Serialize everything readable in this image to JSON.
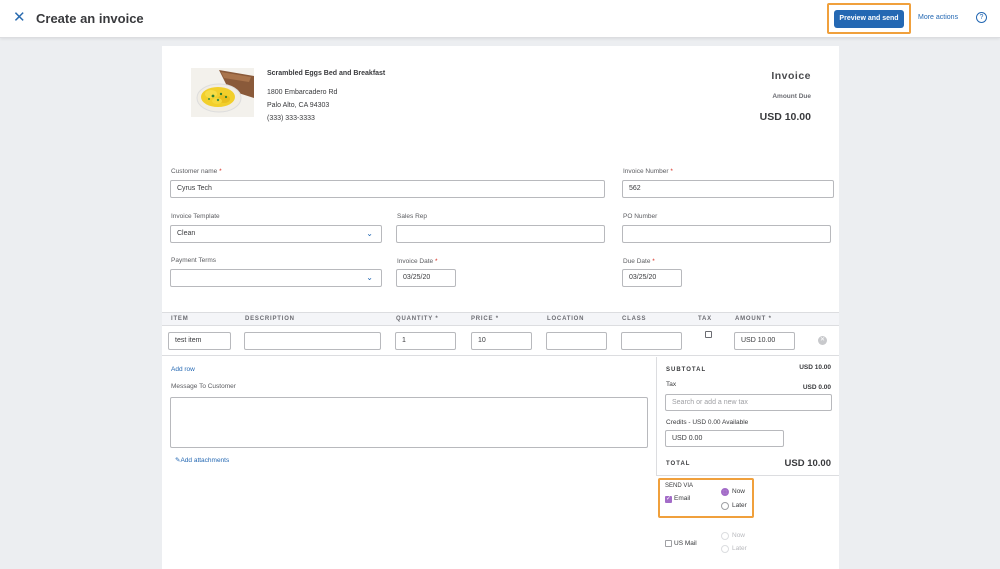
{
  "header": {
    "title": "Create an invoice",
    "primary_button": "Preview and send",
    "more_actions": "More actions",
    "help": "?"
  },
  "company": {
    "name": "Scrambled Eggs Bed and Breakfast",
    "address1": "1800 Embarcadero Rd",
    "address2": "Palo Alto, CA 94303",
    "phone": "(333) 333-3333"
  },
  "summary": {
    "label": "Invoice",
    "amount_due_label": "Amount Due",
    "amount_due": "USD 10.00"
  },
  "fields": {
    "customer_name_label": "Customer name",
    "customer_name": "Cyrus Tech",
    "invoice_number_label": "Invoice Number",
    "invoice_number": "562",
    "template_label": "Invoice Template",
    "template": "Clean",
    "sales_rep_label": "Sales Rep",
    "sales_rep": "",
    "po_number_label": "PO Number",
    "po_number": "",
    "payment_terms_label": "Payment Terms",
    "payment_terms": "",
    "invoice_date_label": "Invoice Date",
    "invoice_date": "03/25/20",
    "due_date_label": "Due Date",
    "due_date": "03/25/20",
    "required_mark": "*"
  },
  "table": {
    "headers": [
      "ITEM",
      "DESCRIPTION",
      "QUANTITY *",
      "PRICE *",
      "LOCATION",
      "CLASS",
      "TAX",
      "AMOUNT *"
    ],
    "row": {
      "item": "test item",
      "description": "",
      "quantity": "1",
      "price": "10",
      "location": "",
      "class": "",
      "amount": "USD 10.00"
    },
    "add_row": "Add row"
  },
  "message": {
    "label": "Message To Customer",
    "value": "",
    "attachments": "Add attachments"
  },
  "totals": {
    "subtotal_label": "SUBTOTAL",
    "subtotal": "USD 10.00",
    "tax_label": "Tax",
    "tax": "USD 0.00",
    "tax_placeholder": "Search or add a new tax",
    "credits_label": "Credits - USD 0.00 Available",
    "credits": "USD 0.00",
    "total_label": "TOTAL",
    "total": "USD 10.00"
  },
  "send_via": {
    "label": "SEND VIA",
    "email": "Email",
    "now": "Now",
    "later": "Later",
    "us_mail": "US Mail",
    "mail_now": "Now",
    "mail_later": "Later"
  },
  "colors": {
    "primary": "#2468b3",
    "highlight": "#f0a03c",
    "radio_selected": "#a36cc8"
  }
}
